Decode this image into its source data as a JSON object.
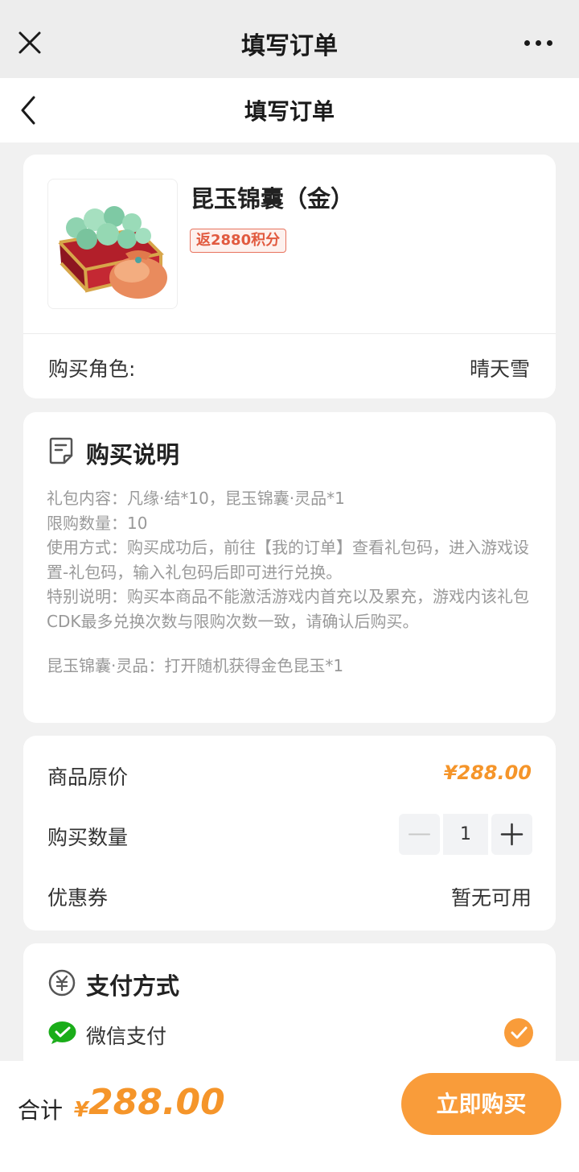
{
  "wechat_bar": {
    "title": "填写订单"
  },
  "nav": {
    "title": "填写订单"
  },
  "product": {
    "name": "昆玉锦囊（金）",
    "badge": "返2880积分",
    "role_label": "购买角色:",
    "role_value": "晴天雪"
  },
  "instructions": {
    "title": "购买说明",
    "lines": [
      "礼包内容：凡缘·结*10，昆玉锦囊·灵品*1",
      "限购数量：10",
      "使用方式：购买成功后，前往【我的订单】查看礼包码，进入游戏设置-礼包码，输入礼包码后即可进行兑换。",
      "特别说明：购买本商品不能激活游戏内首充以及累充，游戏内该礼包CDK最多兑换次数与限购次数一致，请确认后购买。"
    ],
    "extra": "昆玉锦囊·灵品：打开随机获得金色昆玉*1"
  },
  "order": {
    "price_label": "商品原价",
    "price_value": "¥288.00",
    "quantity_label": "购买数量",
    "quantity_value": "1",
    "coupon_label": "优惠券",
    "coupon_value": "暂无可用"
  },
  "payment": {
    "title": "支付方式",
    "method": "微信支付"
  },
  "footer": {
    "total_label": "合计",
    "currency": "¥",
    "total_value": "288.00",
    "buy_label": "立即购买"
  },
  "colors": {
    "accent": "#f99c3a",
    "price": "#f5952a",
    "badge": "#e15a3f",
    "wechat_green": "#1aad19"
  }
}
